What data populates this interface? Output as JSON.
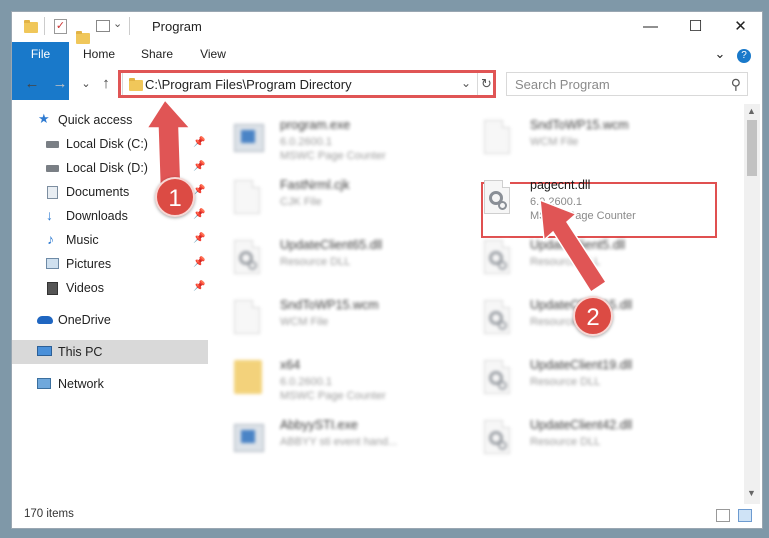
{
  "window": {
    "title": "Program",
    "minimize_glyph": "—",
    "maximize_glyph": "☐",
    "close_glyph": "✕"
  },
  "ribbon": {
    "tabs": [
      "File",
      "Home",
      "Share",
      "View"
    ],
    "expand_glyph": "⌄",
    "help_glyph": "?"
  },
  "address": {
    "path": "C:\\Program Files\\Program Directory",
    "dropdown_glyph": "⌄",
    "refresh_glyph": "↻",
    "search_placeholder": "Search Program",
    "search_glyph": "⚲"
  },
  "nav_buttons": {
    "back": "←",
    "forward": "→",
    "recent": "⌄",
    "up": "↑"
  },
  "sidebar": {
    "items": [
      {
        "label": "Quick access",
        "icon": "star-icon"
      },
      {
        "label": "Local Disk (C:)",
        "icon": "drive-icon",
        "pinned": true
      },
      {
        "label": "Local Disk (D:)",
        "icon": "drive-icon",
        "pinned": true
      },
      {
        "label": "Documents",
        "icon": "documents-icon",
        "pinned": true
      },
      {
        "label": "Downloads",
        "icon": "downloads-icon",
        "pinned": true
      },
      {
        "label": "Music",
        "icon": "music-icon",
        "pinned": true
      },
      {
        "label": "Pictures",
        "icon": "pictures-icon",
        "pinned": true
      },
      {
        "label": "Videos",
        "icon": "videos-icon",
        "pinned": true
      },
      {
        "label": "OneDrive",
        "icon": "cloud-icon"
      },
      {
        "label": "This PC",
        "icon": "monitor-icon",
        "selected": true
      },
      {
        "label": "Network",
        "icon": "network-icon"
      }
    ],
    "pin_glyph": "📌"
  },
  "files": [
    {
      "name": "program.exe",
      "line2": "6.0.2600.1",
      "line3": "MSWC Page Counter",
      "icon": "exe-icon"
    },
    {
      "name": "SndToWP15.wcm",
      "line2": "WCM File",
      "line3": "",
      "icon": "document-icon"
    },
    {
      "name": "FastNrml.cjk",
      "line2": "CJK File",
      "line3": "",
      "icon": "document-icon"
    },
    {
      "name": "pagecnt.dll",
      "line2": "6.0.2600.1",
      "line3": "MSWC Page Counter",
      "icon": "dll-gear-icon"
    },
    {
      "name": "UpdateClient65.dll",
      "line2": "Resource DLL",
      "line3": "",
      "icon": "dll-gear-icon"
    },
    {
      "name": "UpdateClient5.dll",
      "line2": "Resource DLL",
      "line3": "",
      "icon": "dll-gear-icon"
    },
    {
      "name": "SndToWP15.wcm",
      "line2": "WCM File",
      "line3": "",
      "icon": "document-icon"
    },
    {
      "name": "UpdateClient15.dll",
      "line2": "Resource DLL",
      "line3": "",
      "icon": "dll-gear-icon"
    },
    {
      "name": "x64",
      "line2": "6.0.2600.1",
      "line3": "MSWC Page Counter",
      "icon": "folder-icon"
    },
    {
      "name": "UpdateClient19.dll",
      "line2": "Resource DLL",
      "line3": "",
      "icon": "dll-gear-icon"
    },
    {
      "name": "AbbyySTI.exe",
      "line2": "ABBYY sti event hand...",
      "line3": "",
      "icon": "exe-icon"
    },
    {
      "name": "UpdateClient42.dll",
      "line2": "Resource DLL",
      "line3": "",
      "icon": "dll-gear-icon"
    }
  ],
  "status": {
    "item_count": "170 items"
  },
  "annotations": {
    "step1": "1",
    "step2": "2",
    "accent": "#e05555"
  }
}
